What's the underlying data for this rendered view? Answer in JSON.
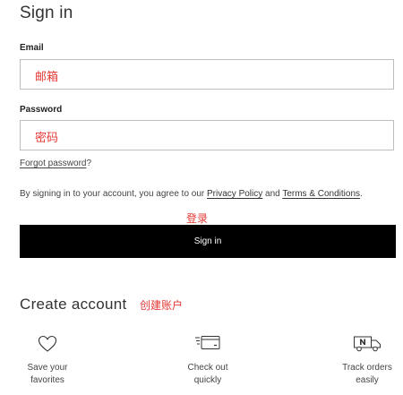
{
  "signin": {
    "title": "Sign in",
    "email_label": "Email",
    "email_annotation": "邮箱",
    "password_label": "Password",
    "password_annotation": "密码",
    "forgot_link": "Forgot password",
    "forgot_suffix": "?",
    "agree_prefix": "By signing in to your account, you agree to our ",
    "privacy_link": "Privacy Policy",
    "agree_and": " and ",
    "terms_link": "Terms & Conditions",
    "agree_suffix": ".",
    "button_annotation": "登录",
    "button_label": "Sign in"
  },
  "create_account": {
    "title": "Create account",
    "annotation": "创建账户",
    "benefits": [
      {
        "icon": "heart-icon",
        "line1": "Save your",
        "line2": "favorites"
      },
      {
        "icon": "card-checkout-icon",
        "line1": "Check out",
        "line2": "quickly"
      },
      {
        "icon": "delivery-truck-icon",
        "line1": "Track orders",
        "line2": "easily"
      }
    ]
  },
  "colors": {
    "annotation": "#e53935",
    "button_bg": "#000000",
    "button_text": "#ffffff",
    "input_border": "#bdbdbd"
  }
}
